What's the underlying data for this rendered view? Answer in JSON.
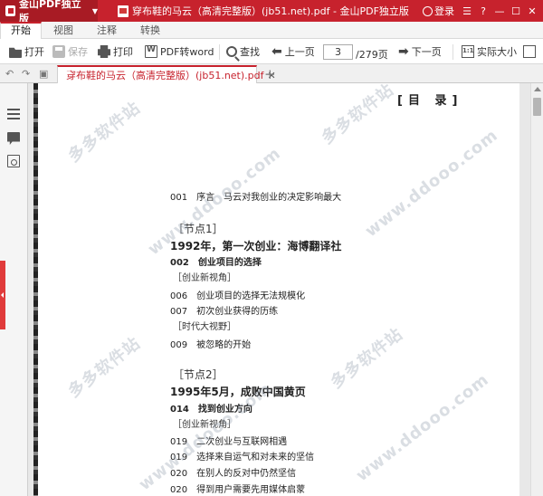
{
  "titlebar": {
    "app_name": "金山PDF独立版",
    "document_title": "穿布鞋的马云（高清完整版）(jb51.net).pdf - 金山PDF独立版",
    "login_label": "登录"
  },
  "ribbon_tabs": [
    {
      "label": "开始",
      "active": true
    },
    {
      "label": "视图",
      "active": false
    },
    {
      "label": "注释",
      "active": false
    },
    {
      "label": "转换",
      "active": false
    }
  ],
  "toolbar": {
    "open": "打开",
    "save": "保存",
    "print": "打印",
    "pdf_to_word": "PDF转word",
    "find": "查找",
    "prev_page": "上一页",
    "current_page": "3",
    "total_pages": "/279页",
    "next_page": "下一页",
    "actual_size": "实际大小"
  },
  "tabs": {
    "document_tab": "穿布鞋的马云（高清完整版）(jb51.net).pdf"
  },
  "document": {
    "toc_title": "[目 录]",
    "lines": {
      "l0": "001　序言　马云对我创业的决定影响最大",
      "l1": "［节点1］",
      "l2": "1992年，第一次创业：海博翻译社",
      "l3": "002　创业项目的选择",
      "l4": "［创业新视角］",
      "l5": "006　创业项目的选择无法规模化",
      "l6": "007　初次创业获得的历练",
      "l7": "［时代大视野］",
      "l8": "009　被忽略的开始",
      "l9": "［节点2］",
      "l10": "1995年5月，成败中国黄页",
      "l11": "014　找到创业方向",
      "l12": "［创业新视角］",
      "l13": "019　二次创业与互联网相遇",
      "l14": "019　选择来自运气和对未来的坚信",
      "l15": "020　在别人的反对中仍然坚信",
      "l16": "020　得到用户需要先用媒体启蒙"
    },
    "watermark_1": "多多软件站",
    "watermark_2": "www.ddooo.com"
  },
  "colors": {
    "brand_red": "#c7222d",
    "sidebar_handle": "#e03a3a"
  }
}
